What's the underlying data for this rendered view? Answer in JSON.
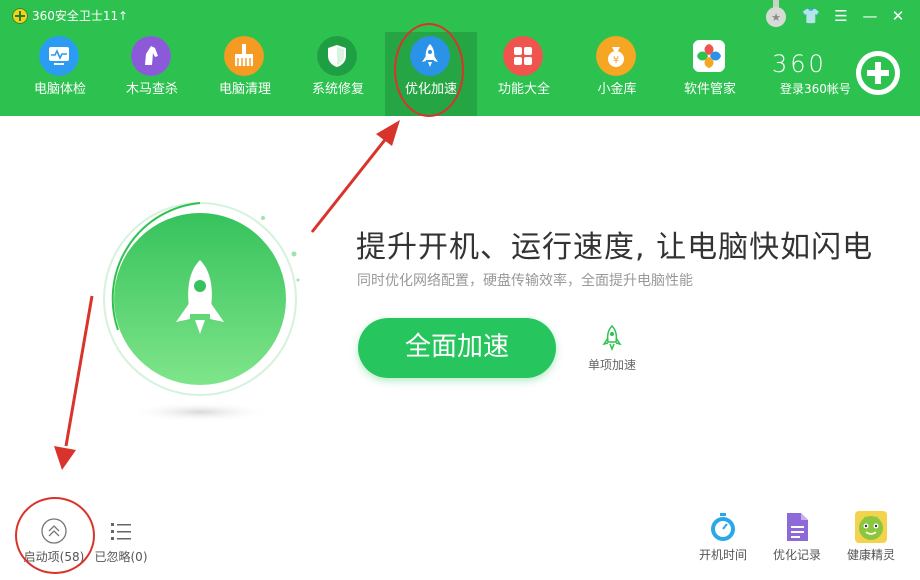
{
  "app": {
    "title": "360安全卫士11",
    "upgrade_icon": "↑"
  },
  "nav": [
    {
      "label": "电脑体检",
      "icon": "monitor-check-icon",
      "color": "#2b9cf2"
    },
    {
      "label": "木马查杀",
      "icon": "horse-icon",
      "color": "#8c5ad9"
    },
    {
      "label": "电脑清理",
      "icon": "broom-icon",
      "color": "#f59a23"
    },
    {
      "label": "系统修复",
      "icon": "shield-icon",
      "color": "#1f9e44"
    },
    {
      "label": "优化加速",
      "icon": "rocket-icon",
      "color": "#2a93e8",
      "active": true
    },
    {
      "label": "功能大全",
      "icon": "grid-icon",
      "color": "#f0544f"
    },
    {
      "label": "小金库",
      "icon": "money-bag-icon",
      "color": "#f5a623"
    },
    {
      "label": "软件管家",
      "icon": "apps-icon",
      "color": "#ffffff"
    }
  ],
  "account": {
    "logo": "360",
    "login_label": "登录360帐号"
  },
  "window_controls": {
    "skin": "👕",
    "menu": "☰",
    "minimize": "—",
    "close": "✕"
  },
  "hero": {
    "headline": "提升开机、运行速度, 让电脑快如闪电",
    "subline": "同时优化网络配置，硬盘传输效率，全面提升电脑性能",
    "primary_button": "全面加速",
    "secondary_label": "单项加速"
  },
  "bottom_left": [
    {
      "label": "启动项(58)",
      "icon": "double-chevron-up-icon"
    },
    {
      "label": "已忽略(0)",
      "icon": "list-icon"
    }
  ],
  "bottom_right": [
    {
      "label": "开机时间",
      "icon": "stopwatch-icon",
      "color": "#2aa8e8"
    },
    {
      "label": "优化记录",
      "icon": "document-icon",
      "color": "#8e6ad8"
    },
    {
      "label": "健康精灵",
      "icon": "sprite-icon",
      "color": "#8cc63f"
    }
  ],
  "colors": {
    "brand_green": "#2dc24f",
    "active_nav": "#25a544",
    "annotation_red": "#d9342b",
    "button_green": "#27c55e"
  }
}
